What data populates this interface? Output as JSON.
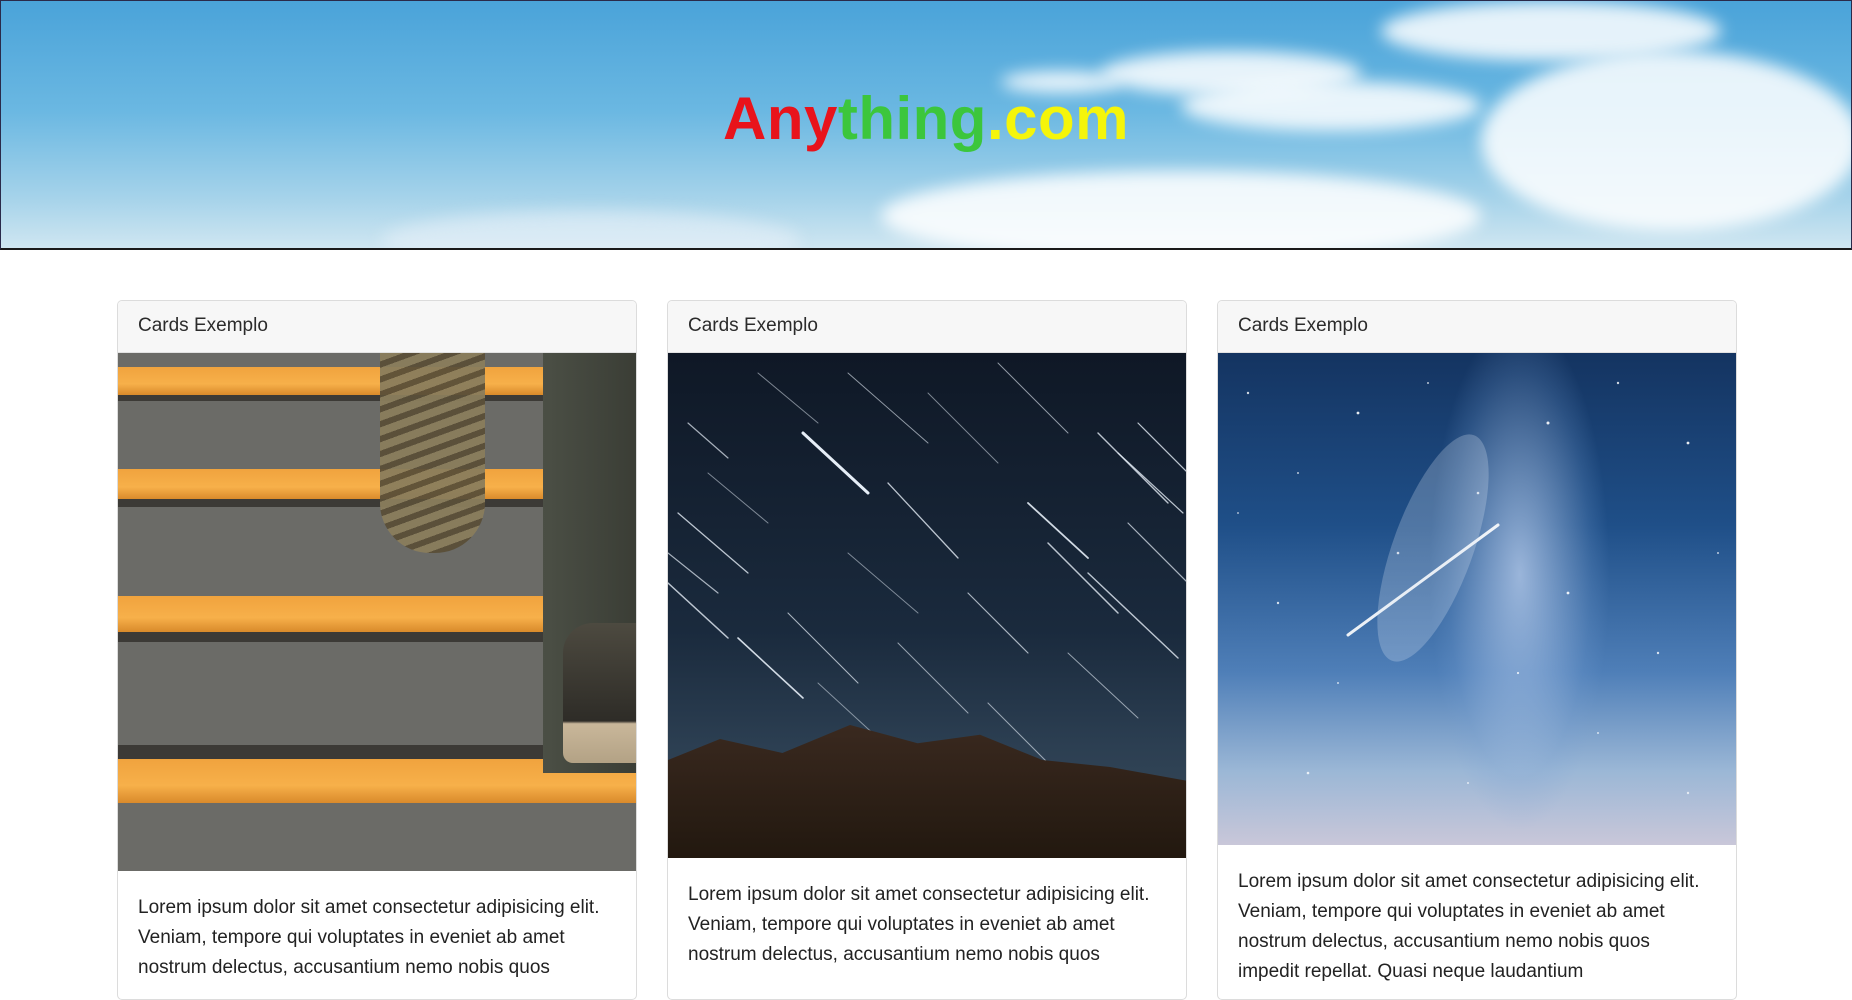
{
  "header": {
    "brand_parts": [
      "Any",
      "thing",
      ".com"
    ],
    "brand_colors": [
      "#e8131b",
      "#3cc63c",
      "#f5f50a"
    ]
  },
  "cards": [
    {
      "title": "Cards Exemplo",
      "image": "stairs-photo",
      "text": "Lorem ipsum dolor sit amet consectetur adipisicing elit. Veniam, tempore qui voluptates in eveniet ab amet nostrum delectus, accusantium nemo nobis quos"
    },
    {
      "title": "Cards Exemplo",
      "image": "star-trails-photo",
      "text": "Lorem ipsum dolor sit amet consectetur adipisicing elit. Veniam, tempore qui voluptates in eveniet ab amet nostrum delectus, accusantium nemo nobis quos"
    },
    {
      "title": "Cards Exemplo",
      "image": "milky-way-photo",
      "text": "Lorem ipsum dolor sit amet consectetur adipisicing elit. Veniam, tempore qui voluptates in eveniet ab amet nostrum delectus, accusantium nemo nobis quos impedit repellat. Quasi neque laudantium"
    }
  ]
}
